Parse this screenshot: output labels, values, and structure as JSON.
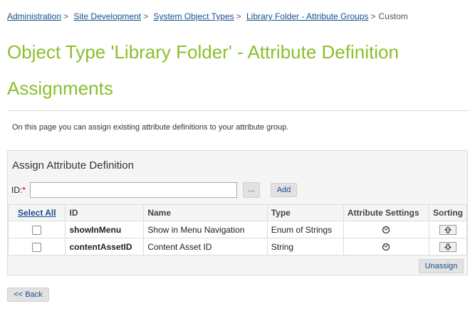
{
  "breadcrumb": {
    "items": [
      "Administration",
      "Site Development",
      "System Object Types",
      "Library Folder - Attribute Groups"
    ],
    "current": "Custom",
    "separator": ">"
  },
  "page": {
    "title": "Object Type 'Library Folder' - Attribute Definition Assignments",
    "intro": "On this page you can assign existing attribute definitions to your attribute group."
  },
  "panel": {
    "title": "Assign Attribute Definition",
    "id_label": "ID:",
    "required_marker": "*",
    "id_value": "",
    "browse_label": "...",
    "add_label": "Add",
    "unassign_label": "Unassign"
  },
  "table": {
    "headers": {
      "select_all": "Select All",
      "id": "ID",
      "name": "Name",
      "type": "Type",
      "attribute_settings": "Attribute Settings",
      "sorting": "Sorting"
    },
    "rows": [
      {
        "id": "showInMenu",
        "name": "Show in Menu Navigation",
        "type": "Enum of Strings",
        "checked": false
      },
      {
        "id": "contentAssetID",
        "name": "Content Asset ID",
        "type": "String",
        "checked": false
      }
    ]
  },
  "footer": {
    "back_label": "<< Back"
  },
  "colors": {
    "title": "#8cbe2e",
    "link": "#1a4e8c",
    "required": "#cc0000"
  },
  "icons": [
    "settings-icon",
    "arrow-up-icon",
    "arrow-down-icon"
  ]
}
